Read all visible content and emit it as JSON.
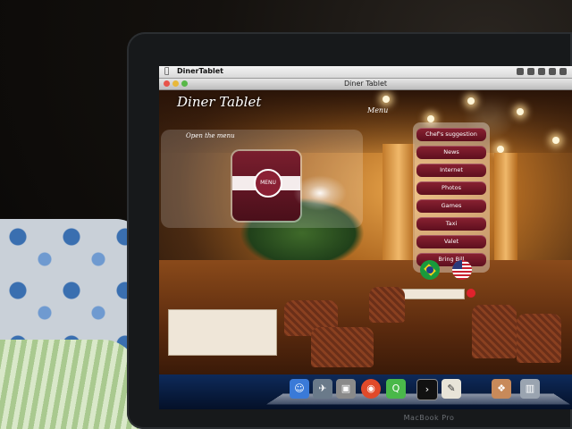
{
  "system": {
    "app_name": "DinerTablet",
    "apple_glyph": "",
    "window_title": "Diner Tablet",
    "device_label": "MacBook Pro"
  },
  "app": {
    "brand_title": "Diner Tablet",
    "menu_heading": "Menu",
    "open_menu_label": "Open the menu",
    "menu_card_badge": "MENU",
    "menu_items": [
      "Chef's suggestion",
      "News",
      "Internet",
      "Photos",
      "Games",
      "Taxi",
      "Valet",
      "Bring Bill"
    ],
    "languages": [
      "brazil-flag-icon",
      "usa-flag-icon"
    ]
  },
  "dock": {
    "icons": [
      "finder-icon",
      "rocket-icon",
      "preview-icon",
      "chrome-icon",
      "qt-icon",
      "terminal-icon",
      "textedit-icon",
      "photo-icon",
      "trash-icon"
    ]
  },
  "colors": {
    "menu_button": "#7a1a2a",
    "dock_bg": "#0e2a5a"
  }
}
